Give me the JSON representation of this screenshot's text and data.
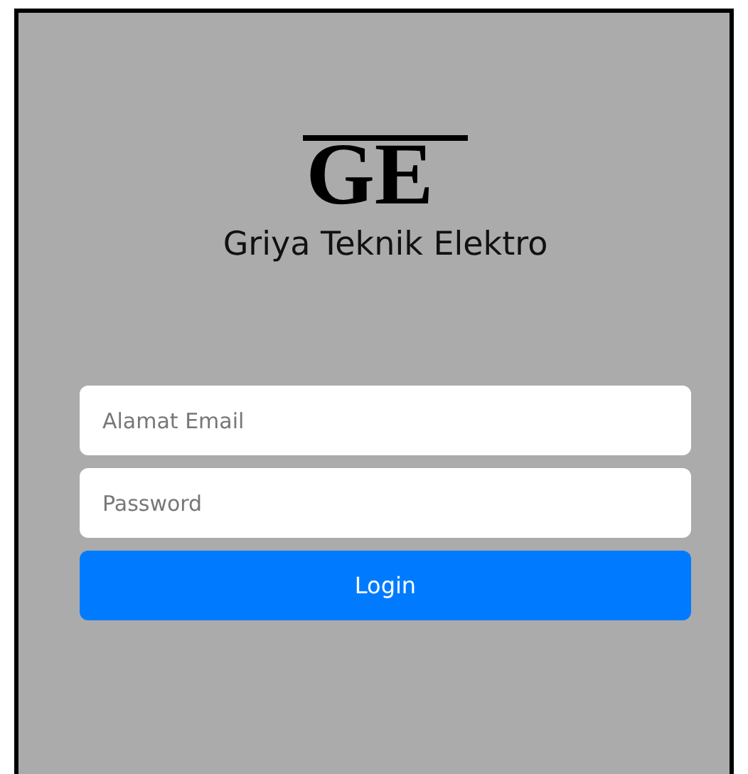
{
  "logo": {
    "text": "GE"
  },
  "brand": {
    "name": "Griya Teknik Elektro"
  },
  "form": {
    "fields": [
      {
        "placeholder": "Alamat Email"
      },
      {
        "placeholder": "Password"
      }
    ],
    "submit": {
      "label": "Login"
    }
  }
}
